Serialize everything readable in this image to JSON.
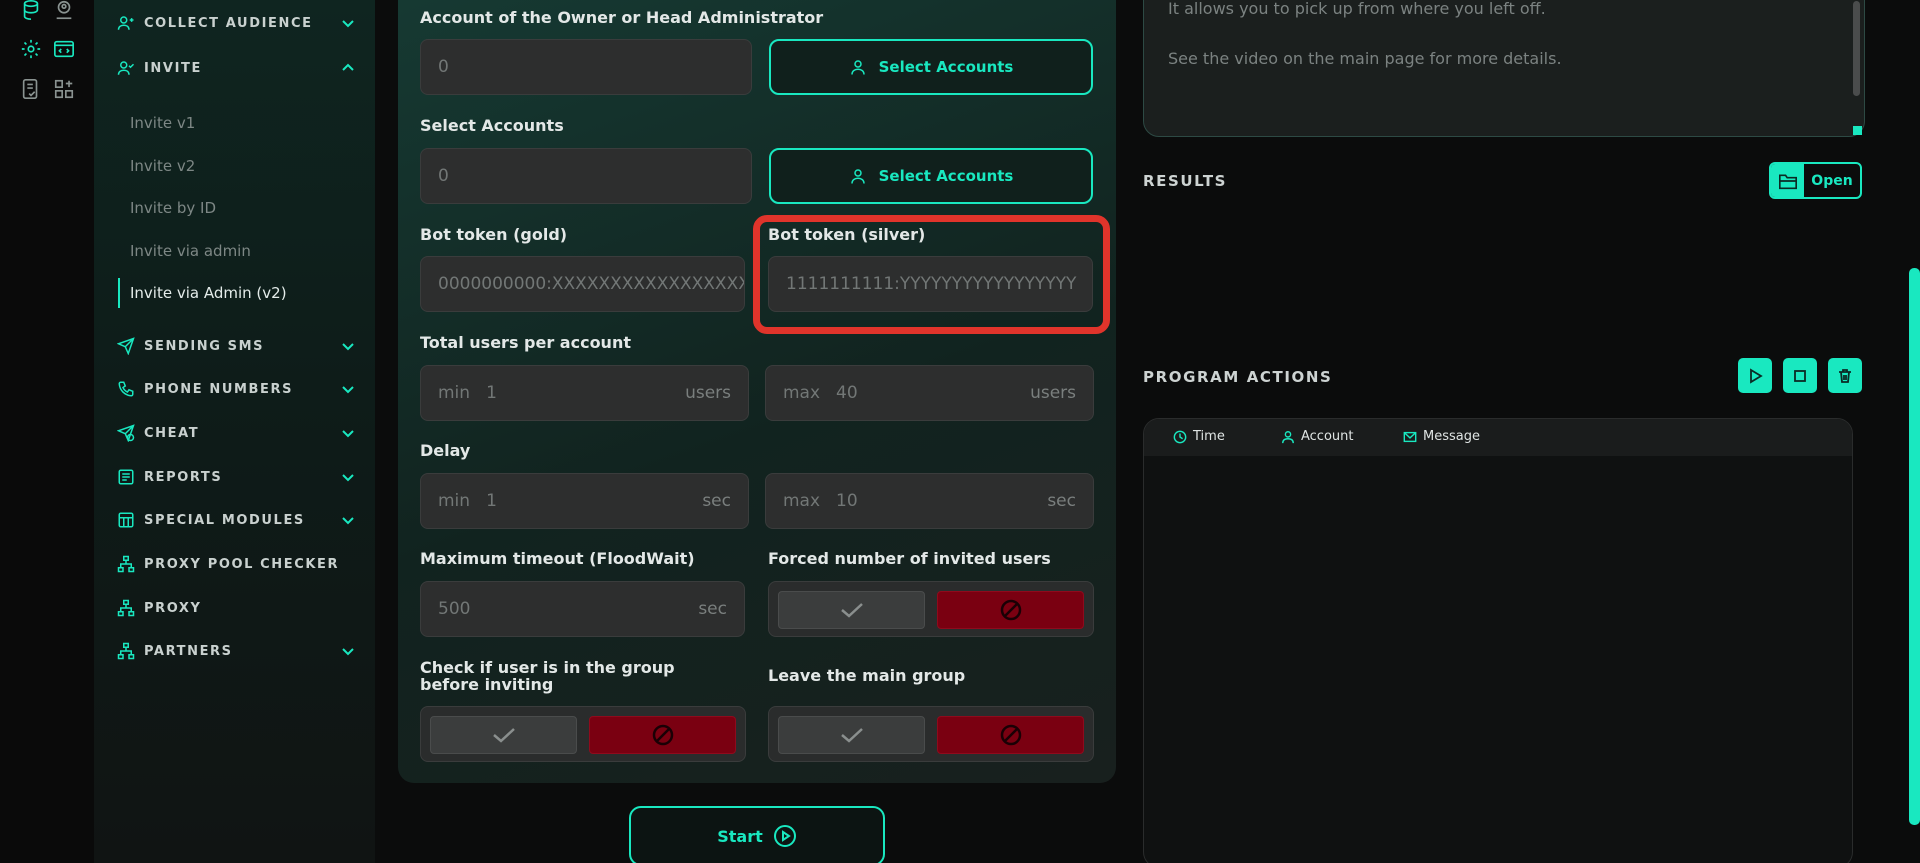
{
  "sidebar": {
    "groups": [
      {
        "label": "COLLECT AUDIENCE",
        "icon": "users-icon",
        "state": "collapsed"
      },
      {
        "label": "INVITE",
        "icon": "add-user-icon",
        "state": "expanded"
      },
      {
        "label": "SENDING SMS",
        "icon": "send-icon",
        "state": "collapsed"
      },
      {
        "label": "PHONE NUMBERS",
        "icon": "phone-icon",
        "state": "collapsed"
      },
      {
        "label": "CHEAT",
        "icon": "send-check-icon",
        "state": "collapsed"
      },
      {
        "label": "REPORTS",
        "icon": "report-icon",
        "state": "collapsed"
      },
      {
        "label": "SPECIAL MODULES",
        "icon": "modules-icon",
        "state": "collapsed"
      },
      {
        "label": "PROXY POOL CHECKER",
        "icon": "network-icon",
        "state": "none"
      },
      {
        "label": "PROXY",
        "icon": "network-icon",
        "state": "none"
      },
      {
        "label": "PARTNERS",
        "icon": "network-icon",
        "state": "collapsed"
      }
    ],
    "invite_items": [
      "Invite v1",
      "Invite v2",
      "Invite by ID",
      "Invite via admin",
      "Invite via Admin (v2)"
    ],
    "active_item": "Invite via Admin (v2)"
  },
  "form": {
    "owner_label": "Account of the Owner or Head Administrator",
    "owner_value": "0",
    "select_accounts_button": "Select Accounts",
    "select_label": "Select Accounts",
    "select_value": "0",
    "bot_gold_label": "Bot token (gold)",
    "bot_gold_placeholder": "0000000000:XXXXXXXXXXXXXXXXX",
    "bot_silver_label": "Bot token (silver)",
    "bot_silver_placeholder": "1111111111:YYYYYYYYYYYYYYYYY",
    "total_users_label": "Total users per account",
    "users_min_prefix": "min",
    "users_min": "1",
    "users_unit": "users",
    "users_max_prefix": "max",
    "users_max": "40",
    "delay_label": "Delay",
    "delay_min_prefix": "min",
    "delay_min": "1",
    "delay_unit": "sec",
    "delay_max_prefix": "max",
    "delay_max": "10",
    "timeout_label": "Maximum timeout (FloodWait)",
    "timeout_value": "500",
    "timeout_unit": "sec",
    "forced_label": "Forced number of invited users",
    "check_group_label": "Check if user is in the group before inviting",
    "leave_group_label": "Leave the main group",
    "start_button": "Start"
  },
  "info": {
    "line1": "It allows you to pick up from where you left off.",
    "line2": "See the video on the main page for more details."
  },
  "results": {
    "title": "RESULTS",
    "open_button": "Open"
  },
  "actions": {
    "title": "PROGRAM ACTIONS",
    "columns": [
      "Time",
      "Account",
      "Message"
    ]
  },
  "colors": {
    "accent": "#19e8c0",
    "danger": "#7a0011",
    "highlight": "#e0342b"
  }
}
